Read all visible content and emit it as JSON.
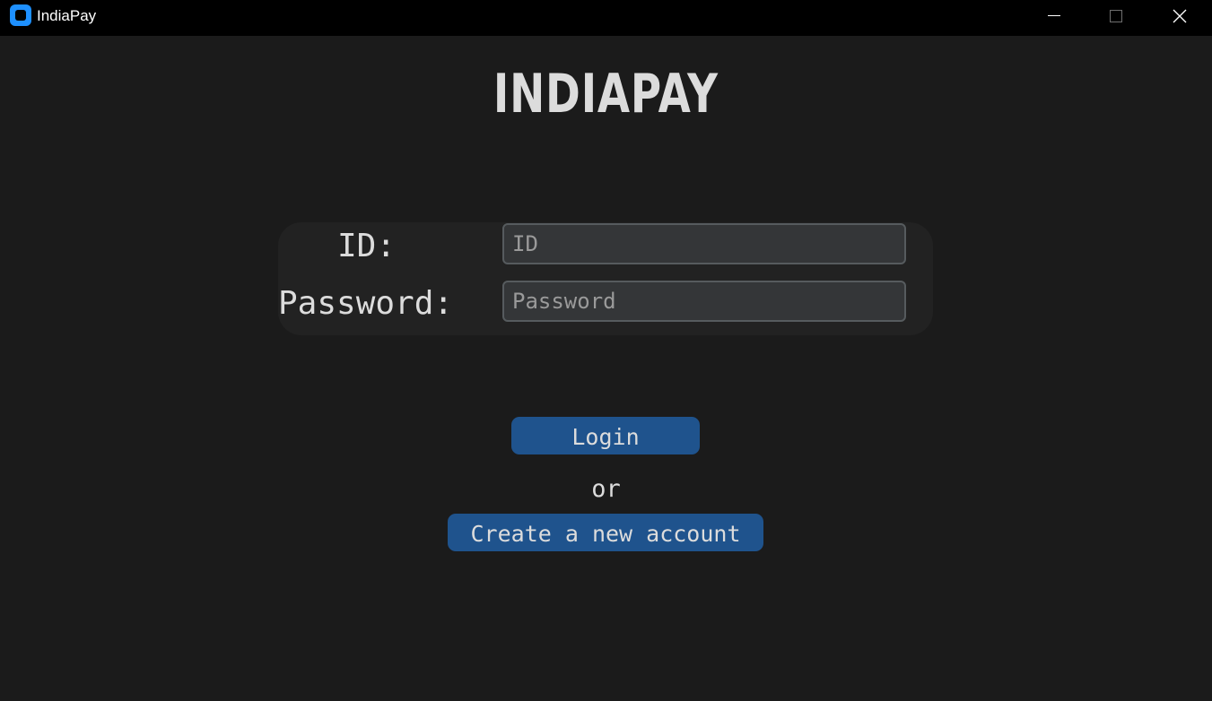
{
  "window": {
    "title": "IndiaPay",
    "app_icon": "app-logo-icon",
    "controls": [
      "minimize-icon",
      "maximize-icon",
      "close-icon"
    ]
  },
  "brand": {
    "title": "INDIAPAY"
  },
  "login_form": {
    "id_label": "ID:",
    "id_placeholder": "ID",
    "id_value": "",
    "password_label": "Password:",
    "password_placeholder": "Password",
    "password_value": ""
  },
  "actions": {
    "login_label": "Login",
    "separator_text": "or",
    "create_account_label": "Create a new account"
  },
  "colors": {
    "background": "#1b1b1b",
    "titlebar": "#000000",
    "panel": "#222222",
    "input_background": "#343638",
    "input_border": "#565b5e",
    "button": "#1f538d",
    "text": "#dcdcdc"
  }
}
